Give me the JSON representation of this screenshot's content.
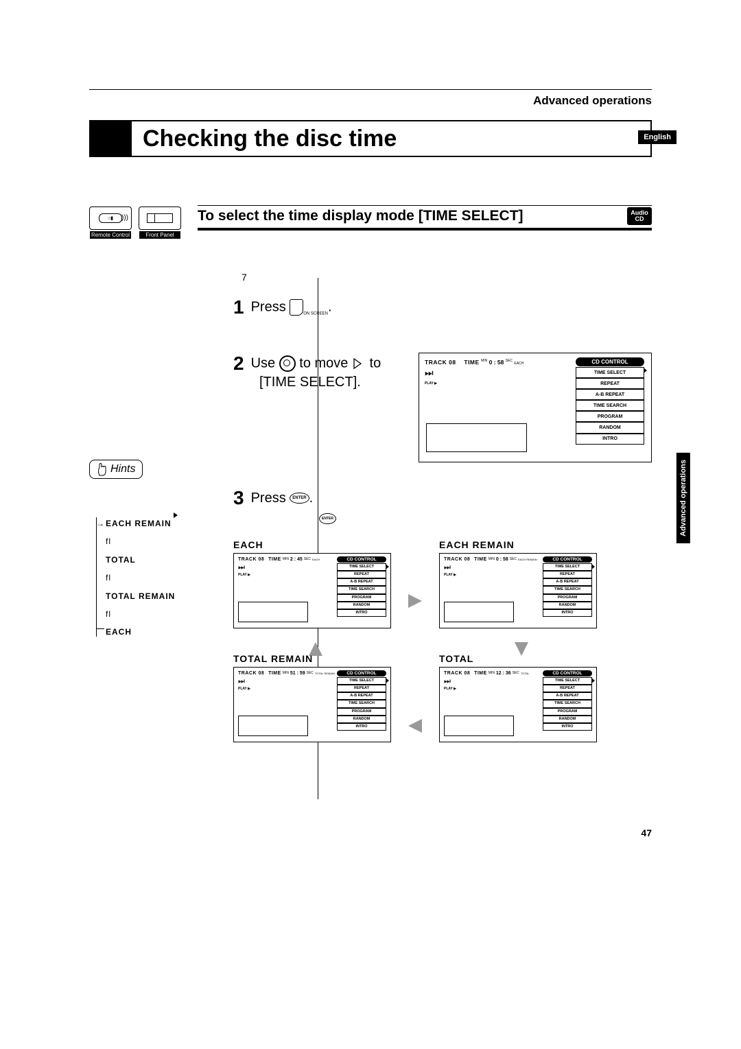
{
  "header": {
    "section": "Advanced operations",
    "language": "English",
    "title": "Checking the disc time"
  },
  "subheader": {
    "remote_caption": "Remote Control",
    "panel_caption": "Front Panel",
    "subtitle": "To select the time display mode [TIME SELECT]",
    "audio_top": "Audio",
    "audio_bottom": "CD"
  },
  "steps": {
    "pre": "7",
    "s1_num": "1",
    "s1_a": "Press ",
    "s1_b": ".",
    "onscreen": "ON SCREEN",
    "s2_num": "2",
    "s2_a": "Use ",
    "s2_b": " to move ",
    "s2_c": " to",
    "s2_line2": "[TIME SELECT].",
    "s3_num": "3",
    "s3_a": "Press ",
    "s3_b": ".",
    "enter": "ENTER"
  },
  "osd": {
    "menu_header": "CD CONTROL",
    "menu": [
      "TIME SELECT",
      "REPEAT",
      "A-B REPEAT",
      "TIME SEARCH",
      "PROGRAM",
      "RANDOM",
      "INTRO"
    ],
    "track_label": "TRACK 08",
    "time_label": "TIME",
    "min": "MIN",
    "sec": "SEC",
    "play": "PLAY ▶",
    "big_time": "0 : 58",
    "big_mode": "EACH",
    "modes": {
      "each": {
        "label": "EACH",
        "time": "2 : 45",
        "mode": "EACH"
      },
      "each_remain": {
        "label": "EACH REMAIN",
        "time": "0 : 58",
        "mode": "EACH REMAIN"
      },
      "total_remain": {
        "label": "TOTAL REMAIN",
        "time": "51 : 59",
        "mode": "TOTAL REMAIN"
      },
      "total": {
        "label": "TOTAL",
        "time": "12 : 36",
        "mode": "TOTAL"
      }
    },
    "fwd": "⏭"
  },
  "hints": {
    "title": "Hints",
    "arrow": "→",
    "items": [
      "EACH REMAIN",
      "TOTAL",
      "TOTAL REMAIN",
      "EACH"
    ],
    "fl": "fl"
  },
  "side_tab": "Advanced operations",
  "page_number": "47"
}
